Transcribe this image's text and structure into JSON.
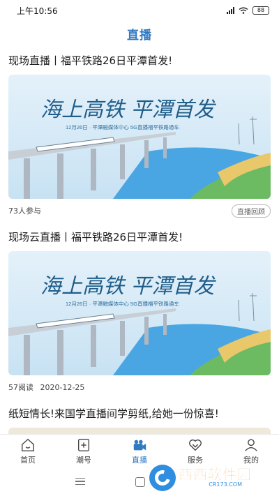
{
  "status": {
    "time": "上午10:56",
    "battery": "88"
  },
  "header": {
    "title": "直播"
  },
  "feed": [
    {
      "title": "现场直播丨福平铁路26日平潭首发!",
      "banner_headline": "海上高铁 平潭首发",
      "banner_sub": "12月26日 · 平潭融媒体中心 5G直播福平铁路通车",
      "stat": "73人参与",
      "badge": "直播回顾"
    },
    {
      "title": "现场云直播丨福平铁路26日平潭首发!",
      "banner_headline": "海上高铁 平潭首发",
      "banner_sub": "12月26日 · 平潭融媒体中心 5G直播福平铁路通车",
      "stat": "57阅读",
      "date": "2020-12-25"
    },
    {
      "title": "纸短情长!来国学直播间学剪纸,给她一份惊喜!"
    }
  ],
  "tabs": [
    {
      "label": "首页",
      "icon": "home-icon"
    },
    {
      "label": "潮号",
      "icon": "add-square-icon"
    },
    {
      "label": "直播",
      "icon": "video-camera-icon",
      "active": true
    },
    {
      "label": "服务",
      "icon": "heart-icon"
    },
    {
      "label": "我的",
      "icon": "user-icon"
    }
  ],
  "watermark": {
    "main": "西西软件园",
    "sub": "CR173.COM"
  },
  "colors": {
    "accent": "#2f78c2",
    "banner_sea": "#5ab0e6",
    "banner_sky": "#cfe6f5"
  }
}
